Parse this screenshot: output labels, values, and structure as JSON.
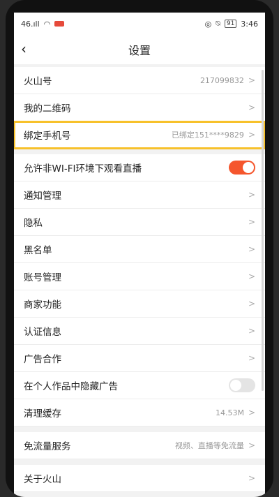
{
  "status_bar": {
    "left_text": "46.ıll",
    "battery": "91",
    "time": "3:46"
  },
  "nav": {
    "title": "设置",
    "back_icon": "chevron-left-icon"
  },
  "group1": [
    {
      "label": "火山号",
      "value": "217099832"
    },
    {
      "label": "我的二维码",
      "value": ""
    },
    {
      "label": "绑定手机号",
      "value": "已绑定151****9829"
    }
  ],
  "group2": {
    "wifi_live": {
      "label": "允许非WI-FI环境下观看直播",
      "on": true
    },
    "items": [
      {
        "label": "通知管理"
      },
      {
        "label": "隐私"
      },
      {
        "label": "黑名单"
      },
      {
        "label": "账号管理"
      },
      {
        "label": "商家功能"
      },
      {
        "label": "认证信息"
      },
      {
        "label": "广告合作"
      }
    ],
    "hide_ads": {
      "label": "在个人作品中隐藏广告",
      "on": false
    },
    "clear_cache": {
      "label": "清理缓存",
      "value": "14.53M"
    }
  },
  "group3": {
    "label": "免流量服务",
    "value": "视频、直播等免流量"
  },
  "group4": {
    "label": "关于火山"
  },
  "colors": {
    "accent": "#f5562d",
    "highlight": "#f7c12b"
  }
}
